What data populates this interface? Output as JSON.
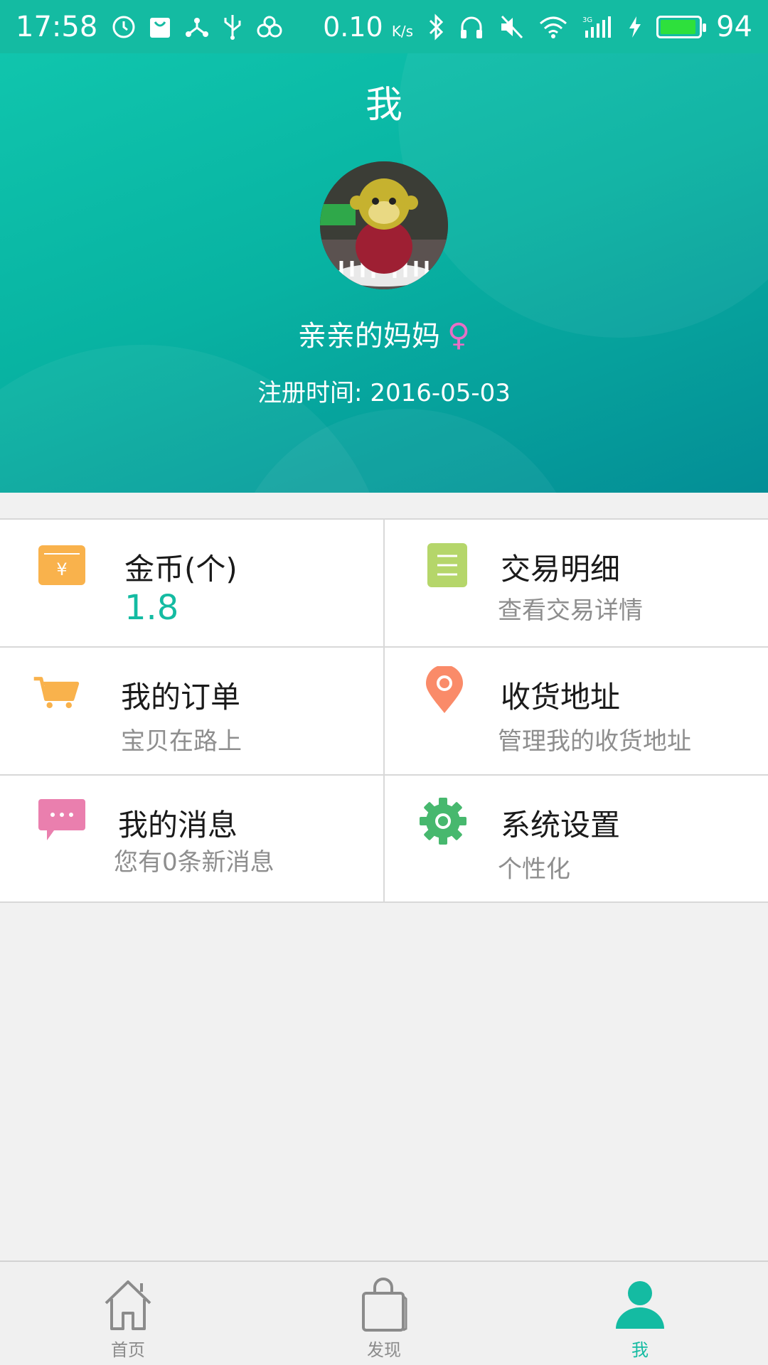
{
  "status_bar": {
    "time": "17:58",
    "speed": "0.10",
    "speed_unit": "K/s",
    "battery": "94"
  },
  "header": {
    "title": "我",
    "username": "亲亲的妈妈",
    "gender_symbol": "♀",
    "reg_label": "注册时间:",
    "reg_date": "2016-05-03"
  },
  "grid": {
    "coins": {
      "label": "金币(个)",
      "value": "1.8"
    },
    "transactions": {
      "label": "交易明细",
      "sub": "查看交易详情"
    },
    "orders": {
      "label": "我的订单",
      "sub": "宝贝在路上"
    },
    "address": {
      "label": "收货地址",
      "sub": "管理我的收货地址"
    },
    "messages": {
      "label": "我的消息",
      "sub": "您有0条新消息"
    },
    "settings": {
      "label": "系统设置",
      "sub": "个性化"
    }
  },
  "bottom_nav": {
    "items": [
      {
        "label": "首页",
        "icon": "home-icon"
      },
      {
        "label": "发现",
        "icon": "shopping-bag-icon"
      },
      {
        "label": "我",
        "icon": "person-icon",
        "active": true
      }
    ]
  },
  "colors": {
    "accent": "#14bba2",
    "coin_icon": "#f9b24c",
    "transaction_icon": "#b5d66a",
    "cart_icon": "#f9b24c",
    "location_icon": "#fa8b69",
    "message_icon": "#ea7fae",
    "settings_icon": "#47b86e",
    "gender": "#e86fc5"
  }
}
